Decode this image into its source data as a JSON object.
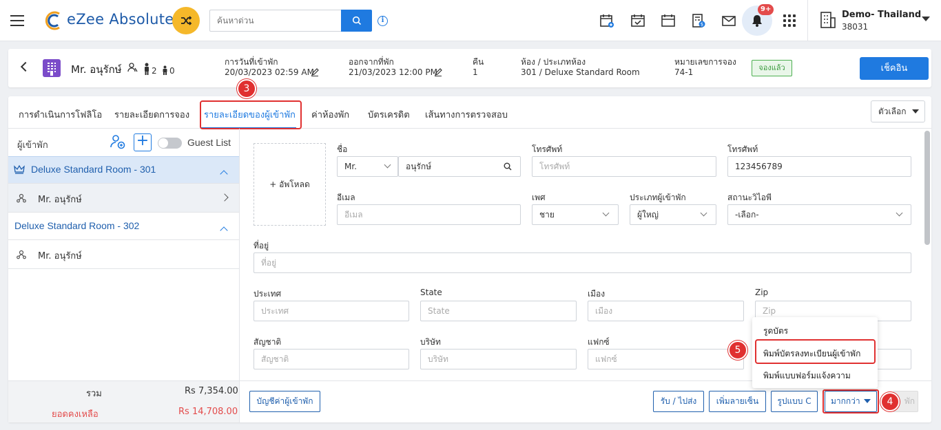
{
  "topbar": {
    "app_name": "eZee Absolute",
    "search_placeholder": "ค้นหาด่วน",
    "notification_badge": "9+",
    "property_name": "Demo- Thailand",
    "property_id": "38031"
  },
  "reservation": {
    "guest_name": "Mr. อนุรักษ์",
    "adults": "2",
    "children": "0",
    "arrival_label": "การวันที่เข้าพัก",
    "arrival_value": "20/03/2023 02:59 AM",
    "departure_label": "ออกจากที่พัก",
    "departure_value": "21/03/2023 12:00 PM",
    "nights_label": "คืน",
    "nights_value": "1",
    "room_label": "ห้อง / ประเภทห้อง",
    "room_value": "301 / Deluxe Standard Room",
    "res_no_label": "หมายเลขการจอง",
    "res_no_value": "74-1",
    "status": "จองแล้ว",
    "checkin_label": "เช็คอิน"
  },
  "tabs": [
    {
      "label": "การดำเนินการโฟลิโอ"
    },
    {
      "label": "รายละเอียดการจอง"
    },
    {
      "label": "รายละเอียดของผู้เข้าพัก"
    },
    {
      "label": "ค่าห้องพัก"
    },
    {
      "label": "บัตรเครดิต"
    },
    {
      "label": "เส้นทางการตรวจสอบ"
    }
  ],
  "options_label": "ตัวเลือก",
  "sidebar": {
    "header_label": "ผู้เข้าพัก",
    "guest_list_label": "Guest List",
    "rooms": [
      {
        "name": "Deluxe Standard Room - 301",
        "guest": "Mr. อนุรักษ์"
      },
      {
        "name": "Deluxe Standard Room - 302",
        "guest": "Mr. อนุรักษ์"
      }
    ],
    "total_label": "รวม",
    "total_value": "Rs 7,354.00",
    "balance_label": "ยอดคงเหลือ",
    "balance_value": "Rs 14,708.00"
  },
  "form": {
    "upload_label": "+ อัพโหลด",
    "name_label": "ชื่อ",
    "salutation": "Mr.",
    "first_name": "อนุรักษ์",
    "phone_label": "โทรศัพท์",
    "phone_placeholder": "โทรศัพท์",
    "mobile_label": "โทรศัพท์",
    "mobile_value": "123456789",
    "email_label": "อีเมล",
    "email_placeholder": "อีเมล",
    "gender_label": "เพศ",
    "gender_value": "ชาย",
    "guest_type_label": "ประเภทผู้เข้าพัก",
    "guest_type_value": "ผู้ใหญ่",
    "wifi_label": "สถานะวิไอพี",
    "wifi_value": "-เลือก-",
    "address_label": "ที่อยู่",
    "address_placeholder": "ที่อยู่",
    "country_label": "ประเทศ",
    "country_placeholder": "ประเทศ",
    "state_label": "State",
    "state_placeholder": "State",
    "city_label": "เมือง",
    "city_placeholder": "เมือง",
    "zip_label": "Zip",
    "zip_placeholder": "Zip",
    "nationality_label": "สัญชาติ",
    "nationality_placeholder": "สัญชาติ",
    "company_label": "บริษัท",
    "company_placeholder": "บริษัท",
    "fax_label": "แฟกซ์",
    "fax_placeholder": "แฟกซ์"
  },
  "actions": {
    "guest_ledger": "บัญชีค่าผู้เข้าพัก",
    "pickup_drop": "รับ / ไปส่ง",
    "add_more": "เพิ่มลายเซ็น",
    "format_c": "รูปแบบ C",
    "more": "มากกว่า",
    "disabled": "พัก"
  },
  "menu": {
    "items": [
      "รูดบัตร",
      "พิมพ์บัตรลงทะเบียนผู้เข้าพัก",
      "พิมพ์แบบฟอร์มแจ้งความ"
    ]
  },
  "steps": [
    "3",
    "4",
    "5"
  ]
}
